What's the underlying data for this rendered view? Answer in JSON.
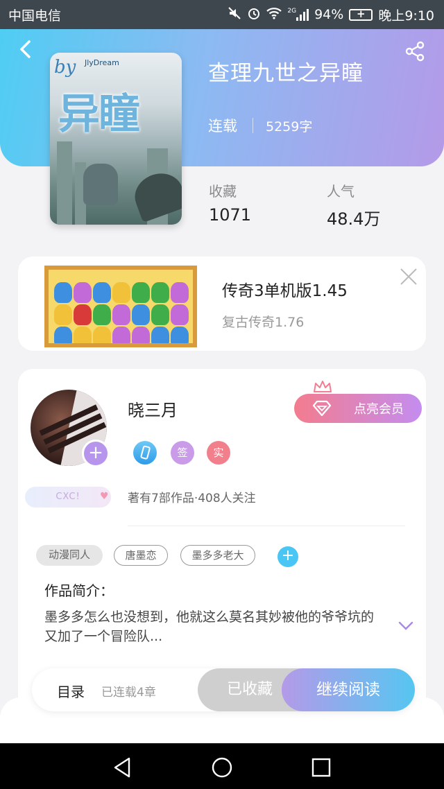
{
  "status_bar": {
    "carrier": "中国电信",
    "network": "2G",
    "battery": "94%",
    "time": "晚上9:10"
  },
  "book": {
    "title": "查理九世之异瞳",
    "status": "连载",
    "word_count": "5259字"
  },
  "cover": {
    "by_text": "by",
    "en_text": "JlyDream",
    "title_text": "异瞳"
  },
  "stats": [
    {
      "label": "收藏",
      "value": "1071"
    },
    {
      "label": "人气",
      "value": "48.4万"
    }
  ],
  "ad": {
    "title": "传奇3单机版1.45",
    "subtitle": "复古传奇1.76"
  },
  "author": {
    "name": "晓三月",
    "vip_label": "点亮会员",
    "badges": [
      "签",
      "实"
    ],
    "nickname_tag": "CXC!",
    "meta": "著有7部作品·408人关注"
  },
  "tags": [
    "动漫同人",
    "唐墨恋",
    "墨多多老大"
  ],
  "intro": {
    "label": "作品简介：",
    "text": "墨多多怎么也没想到，他就这么莫名其妙被他的爷爷坑的又加了一个冒险队..."
  },
  "actions": {
    "toc": "目录",
    "chapters": "已连载4章",
    "collected": "已收藏",
    "read": "继续阅读"
  },
  "colors": {
    "header_start": "#4fcdf3",
    "header_end": "#b49ae8",
    "vip_start": "#f37c8e",
    "vip_end": "#c48df0",
    "accent_blue": "#4ac6f4"
  }
}
